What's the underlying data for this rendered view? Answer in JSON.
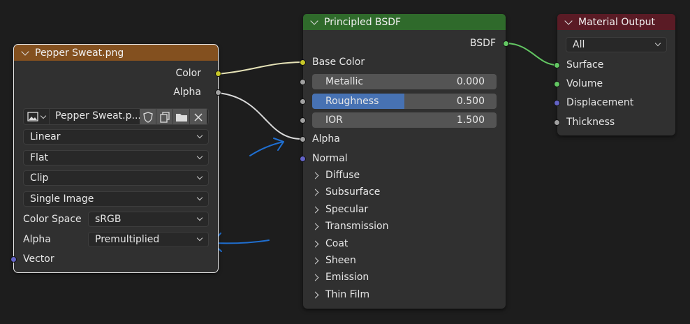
{
  "image_node": {
    "title": "Pepper Sweat.png",
    "outputs": [
      "Color",
      "Alpha"
    ],
    "image_name": "Pepper Sweat.p...",
    "interpolation": "Linear",
    "projection": "Flat",
    "extension": "Clip",
    "source": "Single Image",
    "color_space_label": "Color Space",
    "color_space_value": "sRGB",
    "alpha_label": "Alpha",
    "alpha_value": "Premultiplied",
    "input_vector": "Vector"
  },
  "bsdf_node": {
    "title": "Principled BSDF",
    "output": "BSDF",
    "base_color": "Base Color",
    "metallic_label": "Metallic",
    "metallic_value": "0.000",
    "roughness_label": "Roughness",
    "roughness_value": "0.500",
    "roughness_fraction": 0.5,
    "ior_label": "IOR",
    "ior_value": "1.500",
    "alpha": "Alpha",
    "normal": "Normal",
    "panels": [
      "Diffuse",
      "Subsurface",
      "Specular",
      "Transmission",
      "Coat",
      "Sheen",
      "Emission",
      "Thin Film"
    ]
  },
  "output_node": {
    "title": "Material Output",
    "target": "All",
    "inputs": [
      "Surface",
      "Volume",
      "Displacement",
      "Thickness"
    ]
  },
  "colors": {
    "image_header": "#83501f",
    "shader_header": "#2f6a2b",
    "output_header": "#5a1b25",
    "annotation": "#1f6fd1"
  }
}
